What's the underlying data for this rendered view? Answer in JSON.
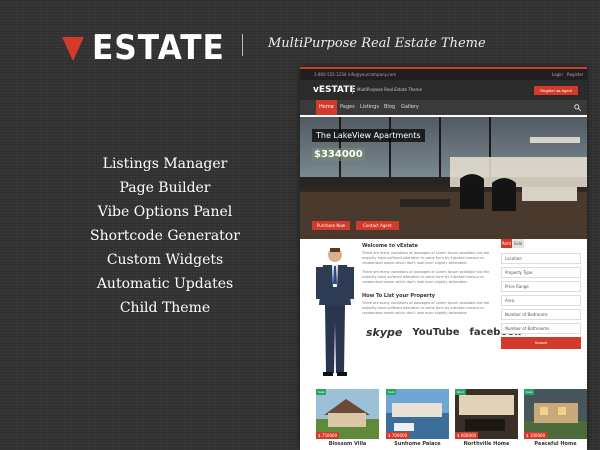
{
  "brand": {
    "logo_text": "ESTATE",
    "tagline": "MultiPurpose Real Estate Theme",
    "accent": "#d23b2b"
  },
  "features": [
    "Listings Manager",
    "Page Builder",
    "Vibe Options Panel",
    "Shortcode Generator",
    "Custom Widgets",
    "Automatic Updates",
    "Child Theme"
  ],
  "preview": {
    "topbar": {
      "phone": "1-800-555-1234",
      "email": "info@yourcompany.com",
      "login": "Login",
      "register": "Register"
    },
    "header": {
      "logo": "vESTATE",
      "tagline": "MultiPurpose Real Estate Theme",
      "register_btn": "Register as Agent"
    },
    "nav": [
      "Home",
      "Pages",
      "Listings",
      "Blog",
      "Gallery"
    ],
    "hero": {
      "title": "The LakeView Apartments",
      "price": "$334000",
      "purchase": "Purchase Now",
      "contact": "Contact Agent"
    },
    "welcome": {
      "heading": "Welcome to vEstate",
      "paragraph1": "There are many variations of passages of Lorem Ipsum available but the majority have suffered alteration in some form by injected humour or randomised words which don't look even slightly believable.",
      "paragraph2": "There are many variations of passages of Lorem Ipsum available but the majority have suffered alteration in some form by injected humour or randomised words which don't look even slightly believable.",
      "how_heading": "How To List your Property",
      "how_text": "There are many variations of passages of Lorem Ipsum available but the majority have suffered alteration in some form by injected humour or randomised words which don't look even slightly believable."
    },
    "brands": [
      "skype",
      "YouTube",
      "facebook"
    ],
    "search": {
      "tab_rent": "Rent",
      "tab_sale": "Sale",
      "fields": [
        "Location",
        "Property Type",
        "Price Range",
        "Area",
        "Number of Bedrooms",
        "Number of Bathrooms"
      ],
      "button": "Search"
    },
    "listings": [
      {
        "name": "Blossom Villa",
        "price": "$ 750000",
        "tag": "Sale"
      },
      {
        "name": "Sunhome Palace",
        "price": "$ 700000",
        "tag": "Sale"
      },
      {
        "name": "Northville Home",
        "price": "$ 600000",
        "tag": "Rent"
      },
      {
        "name": "Peaceful Home",
        "price": "$ 100000",
        "tag": "Sale"
      }
    ]
  }
}
